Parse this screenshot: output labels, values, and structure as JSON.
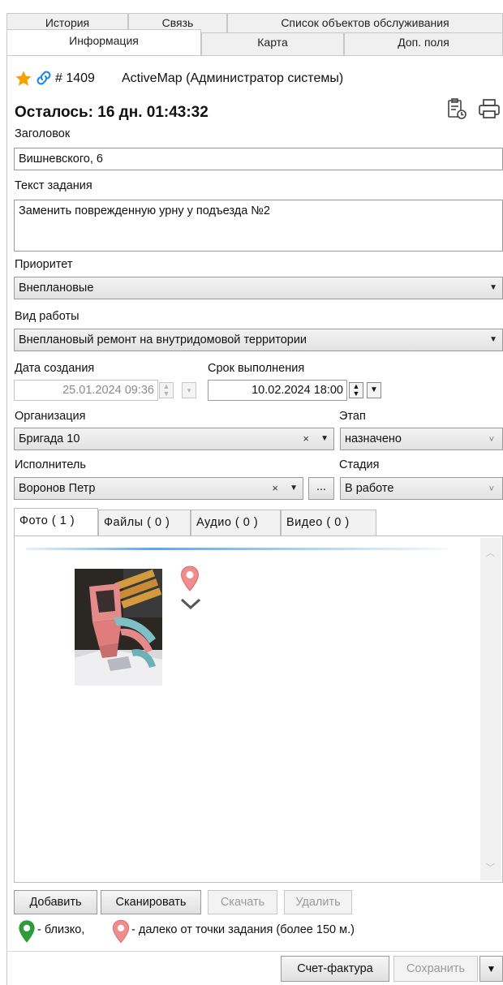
{
  "tabs_top": [
    "История",
    "Связь",
    "Список объектов обслуживания"
  ],
  "tabs_second": [
    "Информация",
    "Карта",
    "Доп. поля"
  ],
  "header": {
    "number_text": "# 1409",
    "title_text": "ActiveMap (Администратор системы)",
    "remaining": "Осталось: 16 дн. 01:43:32"
  },
  "fields": {
    "title_label": "Заголовок",
    "title_value": "Вишневского, 6",
    "task_label": "Текст задания",
    "task_value": "Заменить поврежденную урну у подъезда №2",
    "priority_label": "Приоритет",
    "priority_value": "Внеплановые",
    "worktype_label": "Вид работы",
    "worktype_value": "Внеплановый ремонт на внутридомовой территории",
    "created_label": "Дата создания",
    "created_value": "25.01.2024 09:36",
    "deadline_label": "Срок выполнения",
    "deadline_value": "10.02.2024 18:00",
    "org_label": "Организация",
    "org_value": "Бригада 10",
    "stage_label": "Этап",
    "stage_value": "назначено",
    "executor_label": "Исполнитель",
    "executor_value": "Воронов Петр",
    "status_label": "Стадия",
    "status_value": "В работе",
    "clear_symbol": "×",
    "ellipsis": "..."
  },
  "media_tabs": [
    "Фото ( 1 )",
    "Файлы ( 0 )",
    "Аудио ( 0 )",
    "Видео ( 0 )"
  ],
  "media_buttons": {
    "add": "Добавить",
    "scan": "Сканировать",
    "download": "Скачать",
    "delete": "Удалить"
  },
  "legend": {
    "near": " - близко,",
    "far": " - далеко от точки задания (более 150 м.)"
  },
  "footer": {
    "invoice": "Счет-фактура",
    "save": "Сохранить"
  },
  "colors": {
    "accent": "#1e88e5",
    "star": "#f5a200",
    "pin_near": "#2e9b3a",
    "pin_far": "#f08c8c"
  },
  "icons": [
    "star-icon",
    "link-icon",
    "clipboard-clock-icon",
    "printer-icon",
    "pin-far-icon",
    "check-icon",
    "pin-near-icon",
    "caret-down-icon"
  ]
}
